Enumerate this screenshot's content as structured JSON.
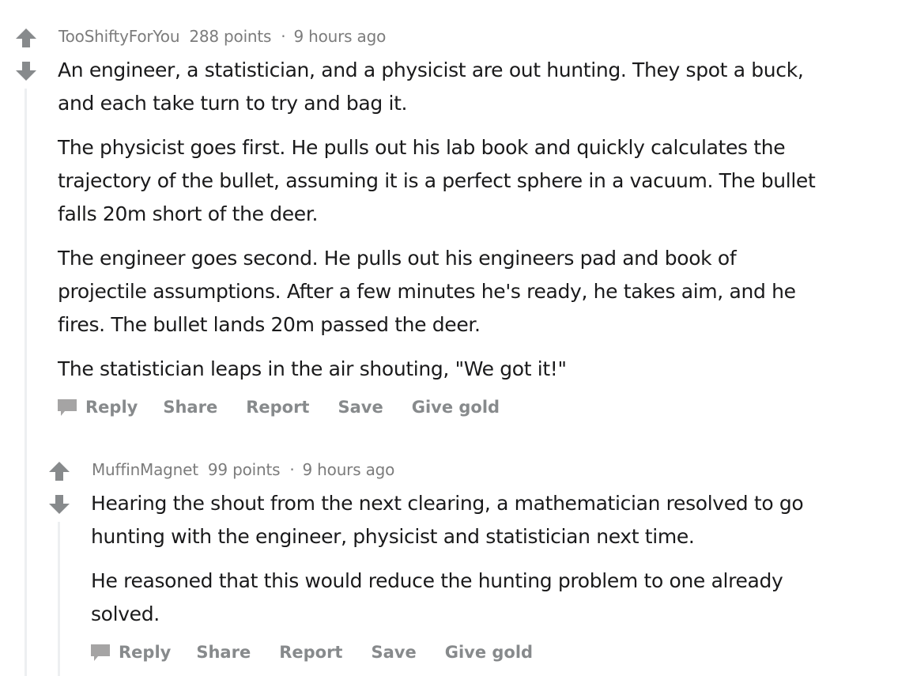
{
  "colors": {
    "text": "#1a1a1b",
    "meta": "#7c7c7c",
    "action": "#878a8c",
    "arrow": "#878a8c",
    "thread_line": "#edeff1"
  },
  "comments": [
    {
      "username": "TooShiftyForYou",
      "points": "288 points",
      "separator": "·",
      "time": "9 hours ago",
      "paragraphs": [
        "An engineer, a statistician, and a physicist are out hunting. They spot a buck,",
        "and each take turn to try and bag it.",
        "The physicist goes first. He pulls out his lab book and quickly calculates the",
        "trajectory of the bullet, assuming it is a perfect sphere in a vacuum. The bullet",
        "falls 20m short of the deer.",
        "The engineer goes second. He pulls out his engineers pad and book of",
        "projectile assumptions. After a few minutes he's ready, he takes aim, and he",
        "fires. The bullet lands 20m passed the deer.",
        "The statistician leaps in the air shouting, \"We got it!\""
      ],
      "actions": {
        "reply": "Reply",
        "share": "Share",
        "report": "Report",
        "save": "Save",
        "give_gold": "Give gold"
      }
    },
    {
      "username": "MuffinMagnet",
      "points": "99 points",
      "separator": "·",
      "time": "9 hours ago",
      "paragraphs": [
        "Hearing the shout from the next clearing, a mathematician resolved to go",
        "hunting with the engineer, physicist and statistician next time.",
        "He reasoned that this would reduce the hunting problem to one already",
        "solved."
      ],
      "actions": {
        "reply": "Reply",
        "share": "Share",
        "report": "Report",
        "save": "Save",
        "give_gold": "Give gold"
      }
    }
  ],
  "icons": {
    "upvote": "arrow-up-icon",
    "downvote": "arrow-down-icon",
    "reply": "speech-bubble-icon"
  }
}
